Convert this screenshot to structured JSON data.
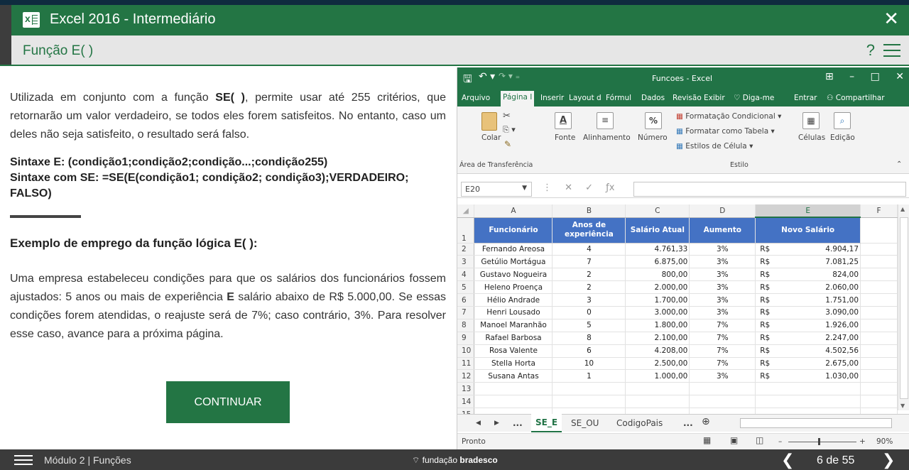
{
  "window": {
    "title": "Excel 2016 - Intermediário",
    "close_glyph": "✕"
  },
  "lesson": {
    "title": "Função E( )",
    "help_glyph": "?"
  },
  "content": {
    "intro_pre": "Utilizada em conjunto com a função ",
    "intro_bold": "SE( )",
    "intro_post": ", permite usar até 255 critérios, que retornarão um valor verdadeiro, se todos eles forem satisfeitos. No entanto, caso um deles não seja satisfeito, o resultado será falso.",
    "syntax_e": "Sintaxe E: (condição1;condição2;condição...;condição255)",
    "syntax_se": "Sintaxe com SE: =SE(E(condição1; condição2; condição3);VERDADEIRO; FALSO)",
    "example_title": "Exemplo de emprego da função lógica E( ):",
    "example_pre": "Uma empresa estabeleceu condições para que os salários dos funcionários fossem ajustados: 5 anos ou mais de experiência ",
    "example_bold": "E",
    "example_post": " salário abaixo de R$ 5.000,00. Se essas condições forem atendidas, o reajuste será de 7%; caso contrário, 3%. Para resolver esse caso, avance para a próxima página.",
    "continue_label": "CONTINUAR"
  },
  "excel": {
    "filename": "Funcoes - Excel",
    "window_buttons": "⊞ – □ ✕",
    "tabs": [
      "Arquivo",
      "Página I",
      "Inserir",
      "Layout d",
      "Fórmul",
      "Dados",
      "Revisão",
      "Exibir",
      "♡ Diga-me",
      "Entrar",
      "Compartilhar"
    ],
    "ribbon": {
      "colar": "Colar",
      "clipboard_group": "Área de Transferência",
      "fonte": "Fonte",
      "alinhamento": "Alinhamento",
      "numero": "Número",
      "cond_format": "Formatação Condicional",
      "format_table": "Formatar como Tabela",
      "cell_styles": "Estilos de Célula",
      "estilo_group": "Estilo",
      "celulas": "Células",
      "edicao": "Edição"
    },
    "name_box": "E20",
    "col_letters": [
      "A",
      "B",
      "C",
      "D",
      "E",
      "F"
    ],
    "headers": [
      "Funcionário",
      "Anos de experiência",
      "Salário Atual",
      "Aumento",
      "Novo Salário"
    ],
    "rows": [
      [
        "Fernando Areosa",
        "4",
        "4.761,33",
        "3%",
        "R$",
        "4.904,17"
      ],
      [
        "Getúlio Mortágua",
        "7",
        "6.875,00",
        "3%",
        "R$",
        "7.081,25"
      ],
      [
        "Gustavo Nogueira",
        "2",
        "800,00",
        "3%",
        "R$",
        "824,00"
      ],
      [
        "Heleno Proença",
        "2",
        "2.000,00",
        "3%",
        "R$",
        "2.060,00"
      ],
      [
        "Hélio Andrade",
        "3",
        "1.700,00",
        "3%",
        "R$",
        "1.751,00"
      ],
      [
        "Henri Lousado",
        "0",
        "3.000,00",
        "3%",
        "R$",
        "3.090,00"
      ],
      [
        "Manoel Maranhão",
        "5",
        "1.800,00",
        "7%",
        "R$",
        "1.926,00"
      ],
      [
        "Rafael Barbosa",
        "8",
        "2.100,00",
        "7%",
        "R$",
        "2.247,00"
      ],
      [
        "Rosa Valente",
        "6",
        "4.208,00",
        "7%",
        "R$",
        "4.502,56"
      ],
      [
        "Stella Horta",
        "10",
        "2.500,00",
        "7%",
        "R$",
        "2.675,00"
      ],
      [
        "Susana Antas",
        "1",
        "1.000,00",
        "3%",
        "R$",
        "1.030,00"
      ]
    ],
    "sheet_tabs": [
      "SE_E",
      "SE_OU",
      "CodigoPais"
    ],
    "status": "Pronto",
    "zoom": "90%"
  },
  "footer": {
    "module": "Módulo 2 | Funções",
    "logo_pre": "fundação",
    "logo_bold": "bradesco",
    "page": "6 de 55"
  }
}
